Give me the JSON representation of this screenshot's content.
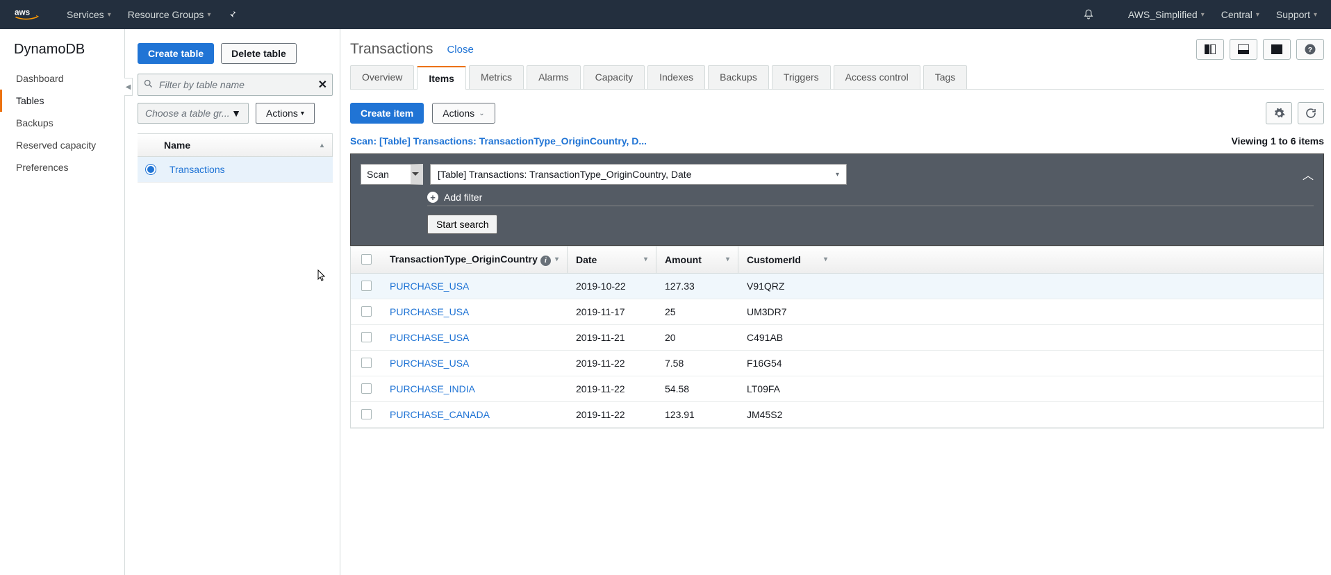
{
  "topnav": {
    "services": "Services",
    "resource_groups": "Resource Groups",
    "account": "AWS_Simplified",
    "region": "Central",
    "support": "Support"
  },
  "sidebar": {
    "service": "DynamoDB",
    "items": [
      {
        "label": "Dashboard",
        "active": false
      },
      {
        "label": "Tables",
        "active": true
      },
      {
        "label": "Backups",
        "active": false
      },
      {
        "label": "Reserved capacity",
        "active": false
      },
      {
        "label": "Preferences",
        "active": false
      }
    ]
  },
  "tables_pane": {
    "create_btn": "Create table",
    "delete_btn": "Delete table",
    "filter_placeholder": "Filter by table name",
    "group_select": "Choose a table gr...",
    "actions": "Actions",
    "header": "Name",
    "rows": [
      {
        "name": "Transactions",
        "selected": true
      }
    ]
  },
  "detail": {
    "title": "Transactions",
    "close": "Close",
    "tabs": [
      "Overview",
      "Items",
      "Metrics",
      "Alarms",
      "Capacity",
      "Indexes",
      "Backups",
      "Triggers",
      "Access control",
      "Tags"
    ],
    "active_tab": "Items",
    "create_item": "Create item",
    "actions": "Actions",
    "scan_summary": "Scan: [Table] Transactions: TransactionType_OriginCountry, D...",
    "viewing": "Viewing 1 to 6 items",
    "scan_panel": {
      "mode": "Scan",
      "index": "[Table] Transactions: TransactionType_OriginCountry, Date",
      "add_filter": "Add filter",
      "start_search": "Start search"
    },
    "columns": [
      "TransactionType_OriginCountry",
      "Date",
      "Amount",
      "CustomerId"
    ],
    "rows": [
      {
        "c0": "PURCHASE_USA",
        "c1": "2019-10-22",
        "c2": "127.33",
        "c3": "V91QRZ"
      },
      {
        "c0": "PURCHASE_USA",
        "c1": "2019-11-17",
        "c2": "25",
        "c3": "UM3DR7"
      },
      {
        "c0": "PURCHASE_USA",
        "c1": "2019-11-21",
        "c2": "20",
        "c3": "C491AB"
      },
      {
        "c0": "PURCHASE_USA",
        "c1": "2019-11-22",
        "c2": "7.58",
        "c3": "F16G54"
      },
      {
        "c0": "PURCHASE_INDIA",
        "c1": "2019-11-22",
        "c2": "54.58",
        "c3": "LT09FA"
      },
      {
        "c0": "PURCHASE_CANADA",
        "c1": "2019-11-22",
        "c2": "123.91",
        "c3": "JM45S2"
      }
    ]
  }
}
